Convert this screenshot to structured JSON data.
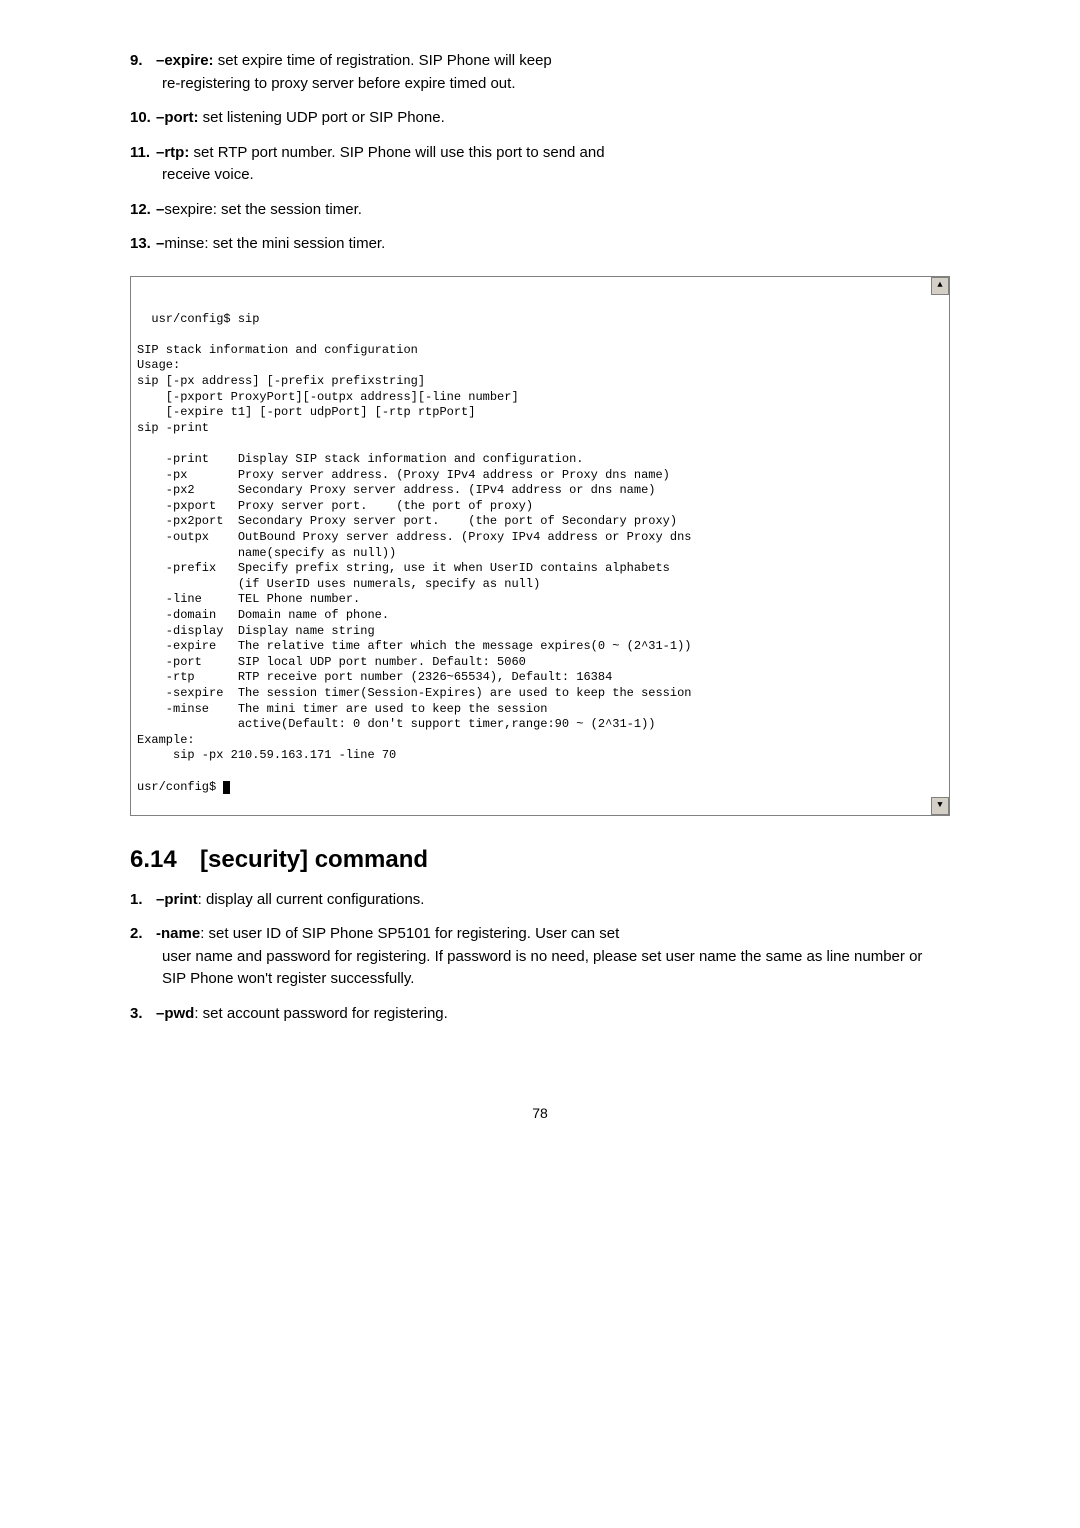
{
  "list1": [
    {
      "num": "9.",
      "opt": "–expire:",
      "text_inline": " set expire time of registration. SIP Phone will keep",
      "text_cont": "re-registering to proxy server before expire timed out."
    },
    {
      "num": "10.",
      "opt": "–port:",
      "text_inline": " set listening UDP port or SIP Phone.",
      "text_cont": ""
    },
    {
      "num": "11.",
      "opt": "–rtp:",
      "text_inline": " set RTP port number. SIP Phone will use this port to send and",
      "text_cont": "receive voice."
    },
    {
      "num": "12.",
      "opt": "–",
      "text_inline": "sexpire: set the session timer.",
      "text_cont": ""
    },
    {
      "num": "13.",
      "opt": "–",
      "text_inline": "minse: set the mini session timer.",
      "text_cont": ""
    }
  ],
  "terminal": "usr/config$ sip\n\nSIP stack information and configuration\nUsage:\nsip [-px address] [-prefix prefixstring]\n    [-pxport ProxyPort][-outpx address][-line number]\n    [-expire t1] [-port udpPort] [-rtp rtpPort]\nsip -print\n\n    -print    Display SIP stack information and configuration.\n    -px       Proxy server address. (Proxy IPv4 address or Proxy dns name)\n    -px2      Secondary Proxy server address. (IPv4 address or dns name)\n    -pxport   Proxy server port.    (the port of proxy)\n    -px2port  Secondary Proxy server port.    (the port of Secondary proxy)\n    -outpx    OutBound Proxy server address. (Proxy IPv4 address or Proxy dns\n              name(specify as null))\n    -prefix   Specify prefix string, use it when UserID contains alphabets\n              (if UserID uses numerals, specify as null)\n    -line     TEL Phone number.\n    -domain   Domain name of phone.\n    -display  Display name string\n    -expire   The relative time after which the message expires(0 ~ (2^31-1))\n    -port     SIP local UDP port number. Default: 5060\n    -rtp      RTP receive port number (2326~65534), Default: 16384\n    -sexpire  The session timer(Session-Expires) are used to keep the session\n    -minse    The mini timer are used to keep the session\n              active(Default: 0 don't support timer,range:90 ~ (2^31-1))\nExample:\n     sip -px 210.59.163.171 -line 70\n\nusr/config$ ",
  "heading": {
    "num": "6.14",
    "title": "[security] command"
  },
  "list2": [
    {
      "num": "1.",
      "opt": "–print",
      "text_inline": ": display all current configurations.",
      "text_cont": ""
    },
    {
      "num": "2.",
      "opt": "-name",
      "text_inline": ": set user ID of SIP Phone SP5101 for registering. User can set",
      "text_cont": "user name and password for registering. If password is no need, please set user name the same as line number or SIP Phone won't register successfully."
    },
    {
      "num": "3.",
      "opt": "–pwd",
      "text_inline": ": set account password for registering.",
      "text_cont": ""
    }
  ],
  "page_number": "78",
  "scroll_up": "▲",
  "scroll_down": "▼"
}
